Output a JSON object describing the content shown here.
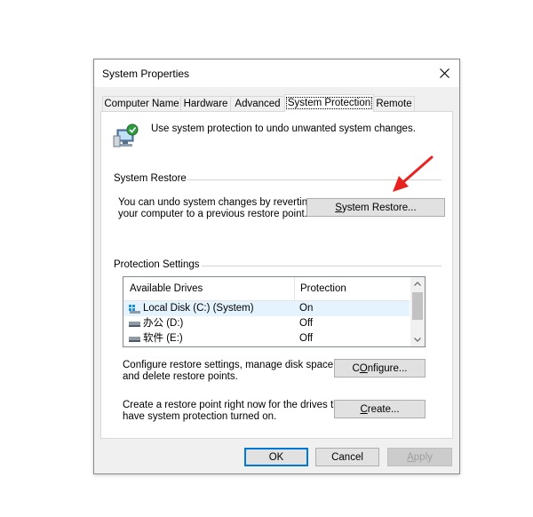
{
  "window": {
    "title": "System Properties"
  },
  "tabs": [
    {
      "label": "Computer Name"
    },
    {
      "label": "Hardware"
    },
    {
      "label": "Advanced"
    },
    {
      "label": "System Protection",
      "active": true
    },
    {
      "label": "Remote"
    }
  ],
  "intro": {
    "text": "Use system protection to undo unwanted system changes."
  },
  "system_restore": {
    "heading": "System Restore",
    "desc_line1": "You can undo system changes by reverting",
    "desc_line2": "your computer to a previous restore point.",
    "button_u": "S",
    "button_rest": "ystem Restore..."
  },
  "protection": {
    "heading": "Protection Settings",
    "col_drives": "Available Drives",
    "col_protection": "Protection",
    "drives": [
      {
        "name": "Local Disk (C:) (System)",
        "protection": "On",
        "icon": "system-drive-icon"
      },
      {
        "name": "办公 (D:)",
        "protection": "Off",
        "icon": "drive-icon"
      },
      {
        "name": "软件 (E:)",
        "protection": "Off",
        "icon": "drive-icon"
      }
    ],
    "configure_line1": "Configure restore settings, manage disk space,",
    "configure_line2": "and delete restore points.",
    "configure_u": "O",
    "configure_pre": "C",
    "configure_rest": "nfigure...",
    "create_line1": "Create a restore point right now for the drives that",
    "create_line2": "have system protection turned on.",
    "create_pre": "",
    "create_u": "C",
    "create_rest": "reate..."
  },
  "footer": {
    "ok": "OK",
    "cancel": "Cancel",
    "apply_u": "A",
    "apply_rest": "pply"
  },
  "colors": {
    "accent": "#0078d7",
    "annotation_arrow": "#e8231f"
  }
}
